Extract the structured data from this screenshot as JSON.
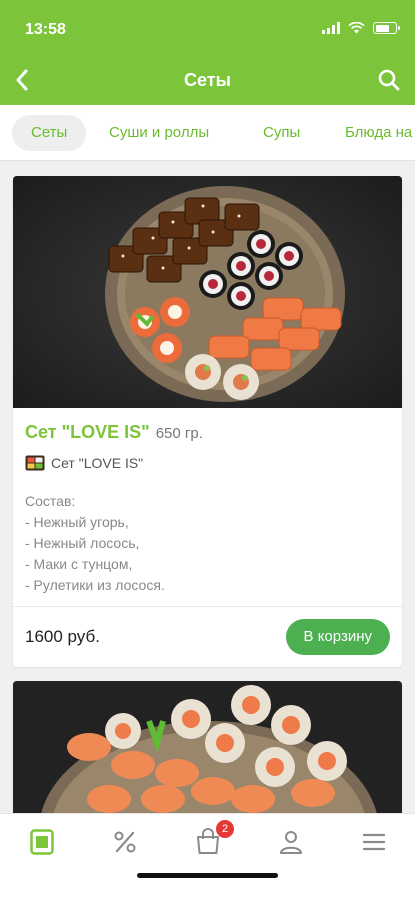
{
  "status_bar": {
    "time": "13:58"
  },
  "navbar": {
    "title": "Сеты"
  },
  "category_tabs": [
    {
      "label": "Сеты",
      "active": true
    },
    {
      "label": "Суши и роллы",
      "active": false
    },
    {
      "label": "Супы",
      "active": false
    },
    {
      "label": "Блюда на",
      "active": false
    }
  ],
  "products": [
    {
      "name": "Сет \"LOVE IS\"",
      "weight": "650 гр.",
      "subtitle": "Сет \"LOVE IS\"",
      "description_lines": [
        "Состав:",
        "- Нежный угорь,",
        "- Нежный лосось,",
        "- Маки с тунцом,",
        "- Рулетики из лосося."
      ],
      "price": "1600 руб.",
      "button_label": "В корзину"
    }
  ],
  "tabbar": {
    "items": [
      {
        "icon": "menu-card-icon",
        "active": true
      },
      {
        "icon": "percent-icon",
        "active": false
      },
      {
        "icon": "cart-icon",
        "active": false,
        "badge": "2"
      },
      {
        "icon": "profile-icon",
        "active": false
      },
      {
        "icon": "hamburger-icon",
        "active": false
      }
    ]
  },
  "colors": {
    "brand": "#7cc53a",
    "button": "#4caf50",
    "badge": "#e53935"
  }
}
